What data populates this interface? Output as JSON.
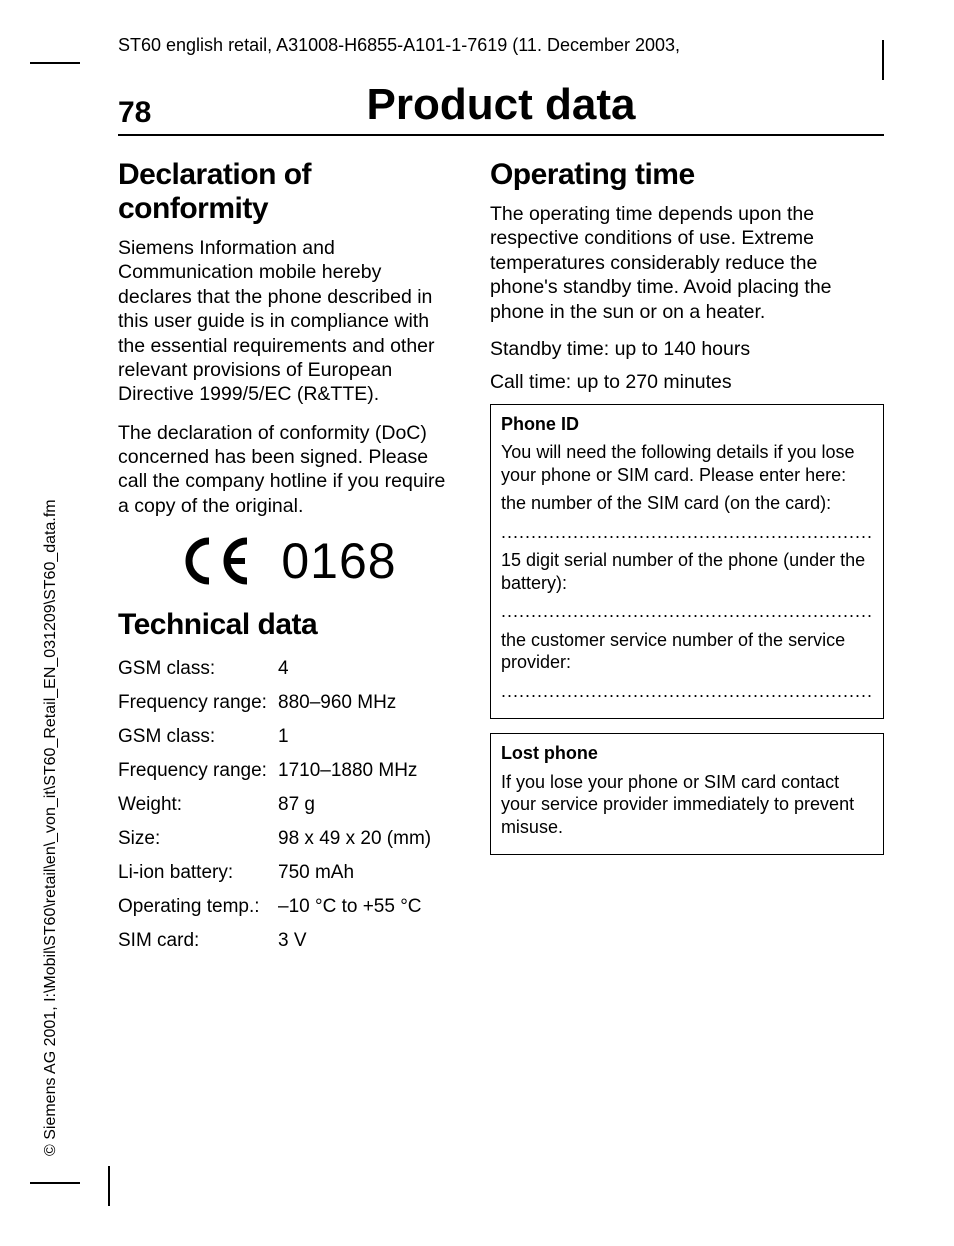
{
  "header_line": "ST60 english retail, A31008-H6855-A101-1-7619 (11. December 2003,",
  "page_number": "78",
  "page_title": "Product data",
  "left": {
    "h_decl": "Declaration of conformity",
    "decl_p1": "Siemens Information and Communication mobile hereby declares that the phone described in this user guide is in compliance with the essential requirements and other relevant provisions of European Directive 1999/5/EC (R&TTE).",
    "decl_p2": "The declaration of conformity (DoC) concerned has been signed. Please call the company hotline if you require a copy of the original.",
    "ce_number": "0168",
    "h_tech": "Technical data",
    "tech_rows": [
      {
        "label": "GSM class:",
        "value": "4"
      },
      {
        "label": "Frequency range:",
        "value": "880–960 MHz"
      },
      {
        "label": "GSM class:",
        "value": "1"
      },
      {
        "label": "Frequency range:",
        "value": "1710–1880 MHz"
      },
      {
        "label": "Weight:",
        "value": "87 g"
      },
      {
        "label": "Size:",
        "value": "98 x 49 x 20 (mm)"
      },
      {
        "label": "Li-ion battery:",
        "value": "750 mAh"
      },
      {
        "label": "Operating temp.:",
        "value": "–10 °C to +55 °C"
      },
      {
        "label": "SIM card:",
        "value": "3 V"
      }
    ]
  },
  "right": {
    "h_op": "Operating time",
    "op_p": "The operating time depends upon the respective conditions of use. Extreme temperatures considerably reduce the phone's standby time. Avoid placing the phone in the sun or on a heater.",
    "standby": "Standby time: up to 140 hours",
    "calltime": "Call time: up to 270 minutes",
    "box1": {
      "title": "Phone ID",
      "p1": "You will need the following details if you lose your phone or SIM card. Please enter here:",
      "p2": "the number of the SIM card (on the card):",
      "p3": "15 digit serial number of the phone (under the battery):",
      "p4": "the customer service number of the service provider:",
      "dots": ".............................................................."
    },
    "box2": {
      "title": "Lost phone",
      "p1": "If you lose your phone or SIM card contact your service provider immediately to prevent misuse."
    }
  },
  "side_text": "© Siemens AG 2001, I:\\Mobil\\ST60\\retail\\en\\_von_it\\ST60_Retail_EN_031209\\ST60_data.fm"
}
